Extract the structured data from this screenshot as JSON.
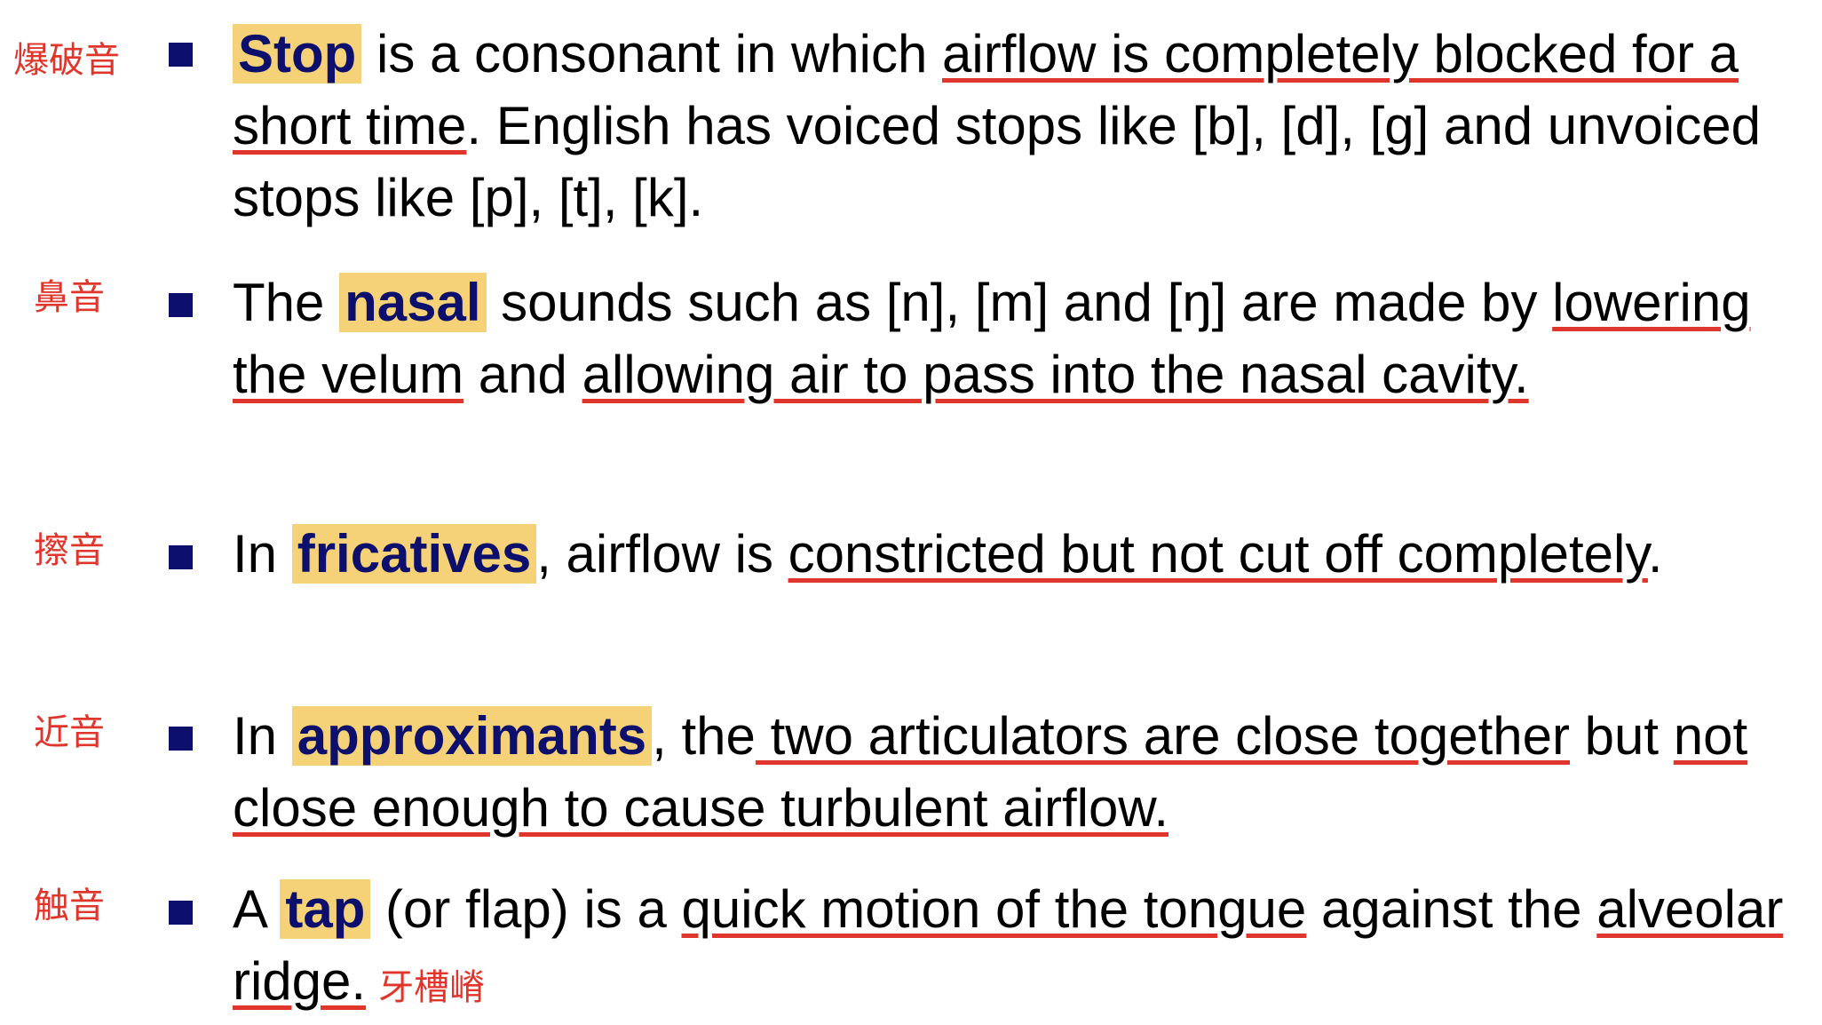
{
  "items": [
    {
      "note": "爆破音",
      "term": "Stop",
      "t1": " is a consonant in which ",
      "u1": "airflow is completely blocked for a short time",
      "t2": ". English has voiced stops like [b], [d], [g] and unvoiced stops like [p], [t], [k]."
    },
    {
      "note": "鼻音",
      "t0": "The ",
      "term": "nasal",
      "t1": " sounds such as [n], [m] and [ŋ] are made by ",
      "u1": "lowering the velum",
      "t2": " and ",
      "u2": "allowing air to pass into the nasal cavity."
    },
    {
      "note": "擦音",
      "t0": "In ",
      "term": "fricatives",
      "t1": ", airflow is ",
      "u1": "constricted but not cut off completely",
      "t2": "."
    },
    {
      "note": "近音",
      "t0": "In ",
      "term": "approximants",
      "t1": ", the",
      "u1": " two articulators are close together",
      "t2": " but ",
      "u2": "not close enough to cause turbulent airflow."
    },
    {
      "note": "触音",
      "t0": "A ",
      "term": "tap",
      "t1": " (or flap) is a ",
      "u1": "quick motion of the tongue",
      "t2": " against the ",
      "u2": "alveolar ridge.",
      "end_note": "牙槽嵴"
    }
  ],
  "colors": {
    "bullet": "#0c0f6b",
    "highlight": "#f5d277",
    "term_text": "#0c0f6b",
    "underline": "#e0352b",
    "annotation": "#e0352b"
  }
}
